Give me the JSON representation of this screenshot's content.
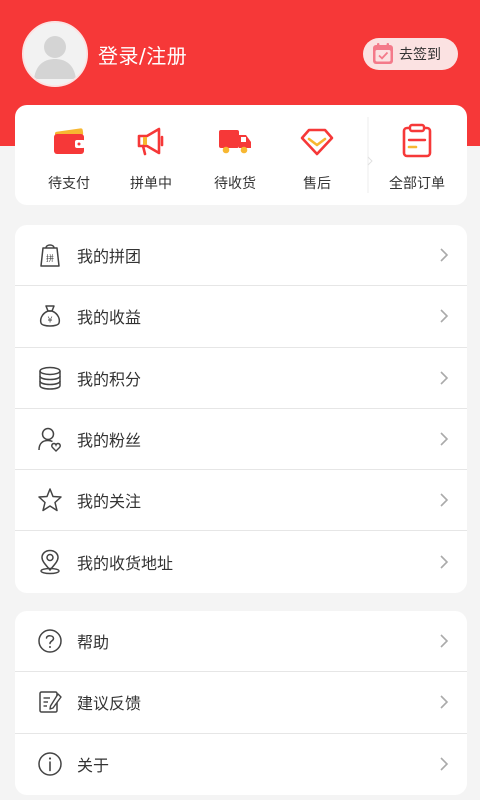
{
  "header": {
    "login_label": "登录/注册",
    "signin_label": "去签到",
    "accent_color": "#f63838"
  },
  "orders": {
    "items": [
      {
        "label": "待支付",
        "icon": "wallet-icon"
      },
      {
        "label": "拼单中",
        "icon": "megaphone-icon"
      },
      {
        "label": "待收货",
        "icon": "truck-icon"
      },
      {
        "label": "售后",
        "icon": "diamond-icon"
      }
    ],
    "all_orders": {
      "label": "全部订单",
      "icon": "clipboard-icon"
    }
  },
  "menu_group_1": [
    {
      "label": "我的拼团",
      "icon": "group-buy-bag-icon"
    },
    {
      "label": "我的收益",
      "icon": "money-bag-icon"
    },
    {
      "label": "我的积分",
      "icon": "coins-stack-icon"
    },
    {
      "label": "我的粉丝",
      "icon": "user-heart-icon"
    },
    {
      "label": "我的关注",
      "icon": "star-icon"
    },
    {
      "label": "我的收货地址",
      "icon": "location-pin-icon"
    }
  ],
  "menu_group_2": [
    {
      "label": "帮助",
      "icon": "help-circle-icon"
    },
    {
      "label": "建议反馈",
      "icon": "feedback-icon"
    },
    {
      "label": "关于",
      "icon": "info-icon"
    }
  ]
}
